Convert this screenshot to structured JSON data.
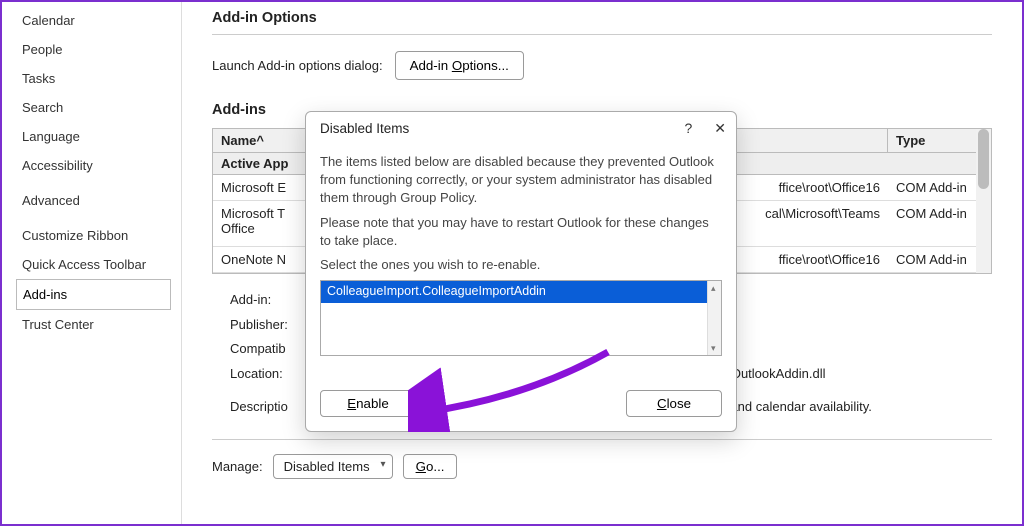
{
  "sidebar": {
    "items": [
      {
        "label": "Calendar"
      },
      {
        "label": "People"
      },
      {
        "label": "Tasks"
      },
      {
        "label": "Search"
      },
      {
        "label": "Language"
      },
      {
        "label": "Accessibility"
      },
      {
        "label": "Advanced"
      },
      {
        "label": "Customize Ribbon"
      },
      {
        "label": "Quick Access Toolbar"
      },
      {
        "label": "Add-ins"
      },
      {
        "label": "Trust Center"
      }
    ],
    "active_index": 9
  },
  "header": {
    "title": "Add-in Options",
    "options_label": "Launch Add-in options dialog:",
    "options_button": "Add-in Options..."
  },
  "addins": {
    "heading": "Add-ins",
    "columns": {
      "name": "Name",
      "location": "",
      "type": "Type"
    },
    "sort_indicator": "^",
    "group_label": "Active App",
    "rows": [
      {
        "name": "Microsoft E",
        "location": "ffice\\root\\Office16",
        "type": "COM Add-in"
      },
      {
        "name": "Microsoft T\nOffice",
        "location": "cal\\Microsoft\\Teams",
        "type": "COM Add-in"
      },
      {
        "name": "OneNote N",
        "location": "ffice\\root\\Office16",
        "type": "COM Add-in"
      }
    ]
  },
  "details": {
    "addin_label": "Add-in:",
    "publisher_label": "Publisher:",
    "compat_label": "Compatib",
    "location_label": "Location:",
    "location_value": "mOutlookAddin.dll",
    "description_label": "Descriptio",
    "description_tail": "rules, and calendar availability."
  },
  "manage": {
    "label": "Manage:",
    "selected": "Disabled Items",
    "go": "Go..."
  },
  "dialog": {
    "title": "Disabled Items",
    "help": "?",
    "close_icon": "✕",
    "para1": "The items listed below are disabled because they prevented Outlook from functioning correctly, or your system administrator has disabled them through Group Policy.",
    "para2": "Please note that you may have to restart Outlook for these changes to take place.",
    "para3": "Select the ones you wish to re-enable.",
    "list_selected": "ColleagueImport.ColleagueImportAddin",
    "enable": "Enable",
    "close": "Close"
  }
}
